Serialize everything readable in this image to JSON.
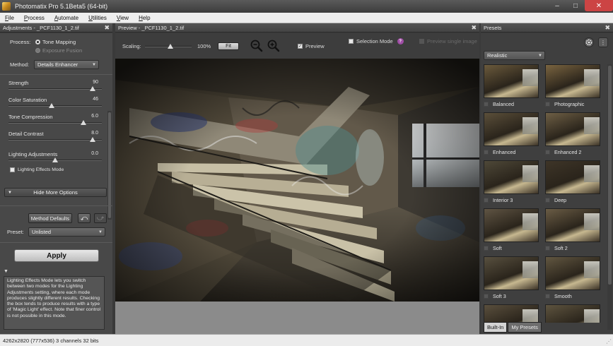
{
  "window": {
    "title": "Photomatix Pro 5.1Beta5 (64-bit)",
    "minimize_glyph": "–",
    "maximize_glyph": "□",
    "close_glyph": "✕"
  },
  "menu": [
    {
      "label": "File",
      "mnemonic": "F",
      "rest": "ile"
    },
    {
      "label": "Process",
      "mnemonic": "P",
      "rest": "rocess"
    },
    {
      "label": "Automate",
      "mnemonic": "A",
      "rest": "utomate"
    },
    {
      "label": "Utilities",
      "mnemonic": "U",
      "rest": "tilities"
    },
    {
      "label": "View",
      "mnemonic": "V",
      "rest": "iew"
    },
    {
      "label": "Help",
      "mnemonic": "H",
      "rest": "elp"
    }
  ],
  "adjustments": {
    "header": "Adjustments - _PCF1130_1_2.tif",
    "close": "✖",
    "process_label": "Process:",
    "process_options": [
      "Tone Mapping",
      "Exposure Fusion"
    ],
    "process_selected": "Tone Mapping",
    "method_label": "Method:",
    "method_value": "Details Enhancer",
    "sliders": [
      {
        "label": "Strength",
        "value": "90",
        "fraction": 0.9
      },
      {
        "label": "Color Saturation",
        "value": "46",
        "fraction": 0.46
      },
      {
        "label": "Tone Compression",
        "value": "6.0",
        "fraction": 0.8
      },
      {
        "label": "Detail Contrast",
        "value": "8.0",
        "fraction": 0.9
      },
      {
        "label": "Lighting Adjustments",
        "value": "0.0",
        "fraction": 0.5
      }
    ],
    "lighting_mode_label": "Lighting Effects Mode",
    "hide_more_label": "Hide More Options",
    "method_defaults_label": "Method Defaults",
    "undo_glyph": "⤺",
    "redo_glyph": "⤻",
    "preset_label": "Preset:",
    "preset_value": "Unlisted",
    "apply_label": "Apply",
    "info_toggle": "▼",
    "info_text": "Lighting Effects Mode lets you switch between two modes for the Lighting Adjustments setting, where each mode produces slightly different results. Checking the box tends to produce results with a type of 'Magic Light' effect. Note that finer control is not possible in this mode."
  },
  "preview": {
    "header": "Preview - _PCF1130_1_2.tif",
    "close": "✖",
    "scaling_label": "Scaling:",
    "scale_percent": "100%",
    "scale_fraction": 0.55,
    "fit_label": "Fit",
    "preview_label": "Preview",
    "preview_checked": true,
    "selection_mode_label": "Selection Mode",
    "help_glyph": "?",
    "single_image_label": "Preview single image"
  },
  "presets": {
    "header": "Presets",
    "close": "✖",
    "settings_icon": "gear-icon",
    "info_glyph": "⋮",
    "category": "Realistic",
    "items": [
      "Balanced",
      "Photographic",
      "Enhanced",
      "Enhanced 2",
      "Interior 3",
      "Deep",
      "Soft",
      "Soft 2",
      "Soft 3",
      "Smooth",
      "",
      ""
    ],
    "tabs": [
      "Built-In",
      "My Presets"
    ],
    "active_tab": "Built-In"
  },
  "status": {
    "text": "4262x2820 (777x536) 3 channels 32 bits",
    "grip": "⋰"
  },
  "colors": {
    "panel_bg": "#484848",
    "header_bg": "#4a4a4a",
    "accent_help": "#a04ea6"
  }
}
